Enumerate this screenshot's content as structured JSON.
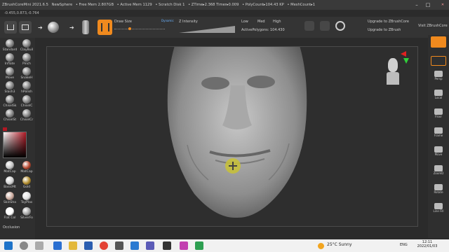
{
  "titlebar": {
    "app": "ZBrushCoreMini 2021.6.5",
    "project": "NewSphere",
    "free_mem": "• Free Mem 2.807GB",
    "active_mem": "• Active Mem 1129",
    "scratch_disk": "• Scratch Disk 1",
    "ztime": "• ZTime▸2.368 Timer▸0.009",
    "polycount": "• PolyCount▸104.43 KP",
    "meshcount": "• MeshCount▸1",
    "upgrade_core": "Upgrade to ZBrushCore",
    "upgrade_zbrush": "Upgrade to ZBrush",
    "visit": "Visit ZBrushCore"
  },
  "coords": "-0.455,0.873,-0.764",
  "toolbar": {
    "draw_size_label": "Draw Size",
    "dynamic_label": "Dynamic",
    "z_intensity_label": "Z Intensity",
    "low": "Low",
    "med": "Med",
    "high": "High",
    "active_polygons": "ActivePolygons: 104.430"
  },
  "brushes": [
    {
      "label": "Standard",
      "name": "brush-standard"
    },
    {
      "label": "ClayBuil",
      "name": "brush-claybuildup"
    },
    {
      "label": "Inflate",
      "name": "brush-inflate"
    },
    {
      "label": "Pinch",
      "name": "brush-pinch"
    },
    {
      "label": "Move",
      "name": "brush-move"
    },
    {
      "label": "SnakeH",
      "name": "brush-snakehook"
    },
    {
      "label": "Slash3",
      "name": "brush-slash3"
    },
    {
      "label": "hPolish",
      "name": "brush-hpolish"
    },
    {
      "label": "ChiselSk",
      "name": "brush-chisel-sk"
    },
    {
      "label": "ChiselC",
      "name": "brush-chisel-c"
    },
    {
      "label": "ChiselSt",
      "name": "brush-chisel-st"
    },
    {
      "label": "ChiselCr",
      "name": "brush-chisel-cr"
    }
  ],
  "materials": [
    {
      "label": "MatCap",
      "name": "material-matcap",
      "color": "#c0c0c0"
    },
    {
      "label": "MatCap",
      "name": "material-matcap-red",
      "color": "#b5452d"
    },
    {
      "label": "BasicMt",
      "name": "material-basic",
      "color": "#d0d0d0"
    },
    {
      "label": "Gold",
      "name": "material-gold",
      "color": "#b08a2a"
    },
    {
      "label": "SkinSha",
      "name": "material-skinshade",
      "color": "#c9a79a"
    },
    {
      "label": "ToyPlas",
      "name": "material-toyplastic",
      "color": "#e0e0e0"
    },
    {
      "label": "Flat Col",
      "name": "material-flatcolor",
      "color": "#ffffff"
    },
    {
      "label": "SilverFo",
      "name": "material-silverfoil",
      "color": "#a0a0a0"
    }
  ],
  "occlusion_label": "Occlusion",
  "right_shelf": [
    {
      "label": "Persp",
      "name": "persp-button"
    },
    {
      "label": "Local",
      "name": "local-button"
    },
    {
      "label": "Floor",
      "name": "floor-button"
    },
    {
      "label": "Frame",
      "name": "frame-button"
    },
    {
      "label": "Move",
      "name": "move-button"
    },
    {
      "label": "ZoomD",
      "name": "zoom-button"
    },
    {
      "label": "Rotate",
      "name": "rotate-button"
    },
    {
      "label": "Line Fill",
      "name": "linefill-button"
    }
  ],
  "taskbar": {
    "weather": "25°C  Sunny",
    "lang": "ENG",
    "time": "12:11",
    "date": "2022/01/03"
  },
  "colors": {
    "accent": "#f08a1e",
    "swatch": "#b01824"
  }
}
